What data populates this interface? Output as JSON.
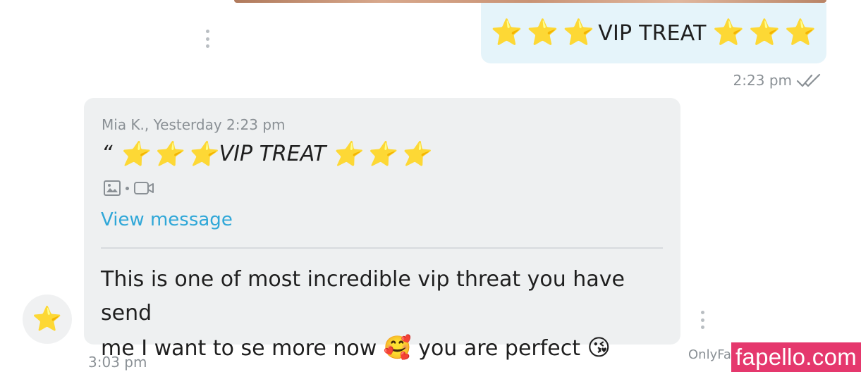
{
  "sent_message": {
    "text": "VIP TREAT",
    "stars_before": "⭐",
    "stars_after": "⭐",
    "time": "2:23 pm",
    "status_icon": "double-check-icon"
  },
  "received_message": {
    "quote": {
      "author_line": "Mia K., Yesterday 2:23 pm",
      "quote_mark": "“",
      "text": "VIP TREAT",
      "star": "⭐",
      "media_icons": [
        "image-icon",
        "video-icon"
      ]
    },
    "view_message_label": "View message",
    "text_line1": "This is one of most incredible vip threat you have send",
    "text_line2": "me I want to se more now",
    "emoji_1": "🥰",
    "text_line2_end": "you are perfect",
    "emoji_2": "😘",
    "time": "3:03 pm"
  },
  "avatar": {
    "emoji": "⭐"
  },
  "footer": {
    "source_text": "OnlyFa",
    "watermark": "fapello.com"
  },
  "colors": {
    "sent_bubble": "#e5f4fa",
    "received_bubble": "#eef0f1",
    "link": "#2fa7d8",
    "meta_text": "#8a9095",
    "watermark_bg": "#e5386d"
  }
}
